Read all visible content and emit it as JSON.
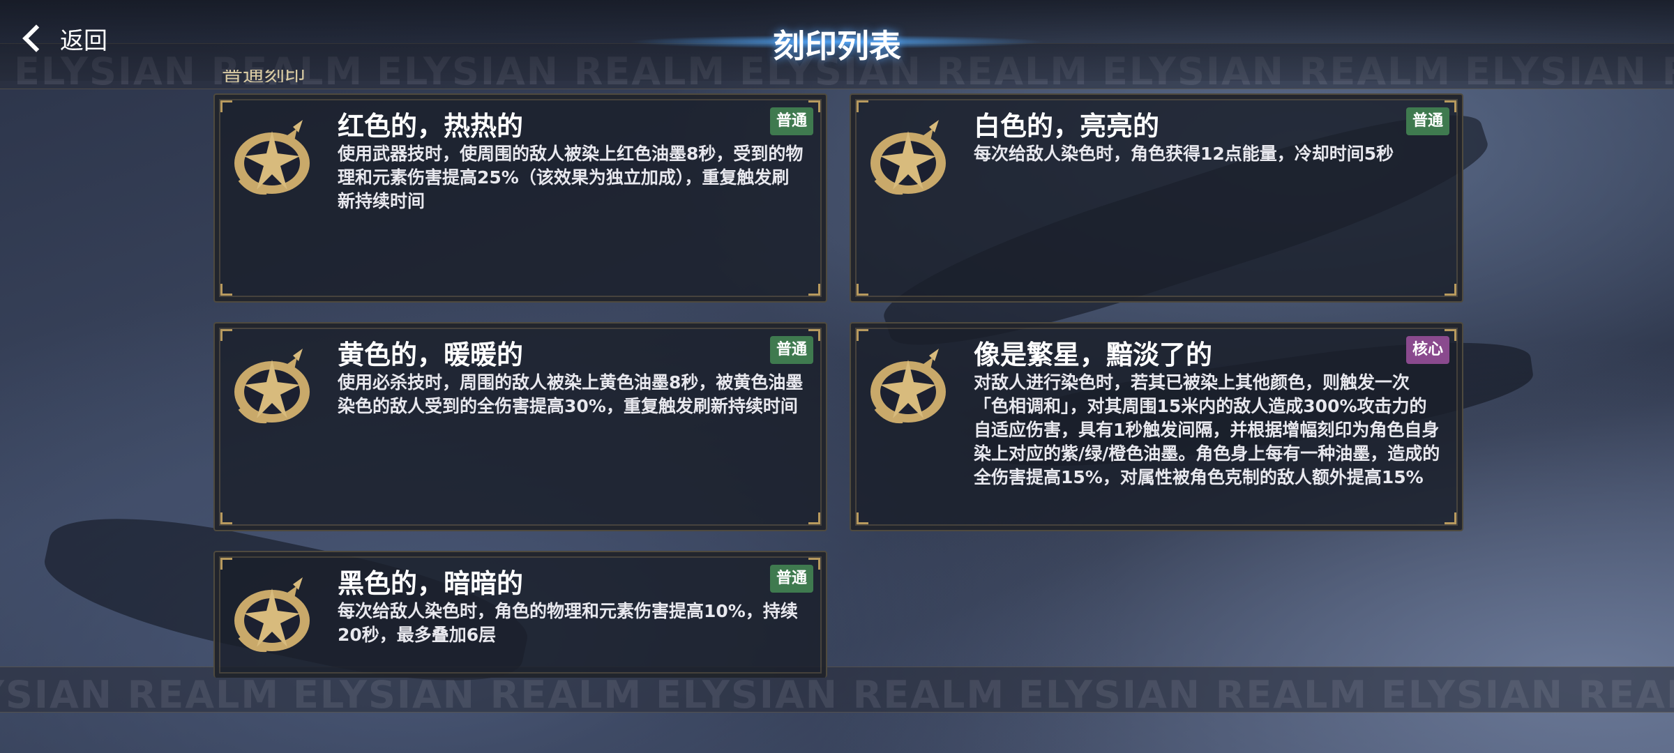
{
  "header": {
    "back_label": "返回",
    "title": "刻印列表",
    "watermark": "ELYSIAN REALM"
  },
  "partial_label": "普通刻印",
  "badge_colors": {
    "普通": "#3f7a4f",
    "核心": "#8a4a8e"
  },
  "cards": [
    {
      "title": "红色的，热热的",
      "badge": "普通",
      "description": "使用武器技时，使周围的敌人被染上红色油墨8秒，受到的物理和元素伤害提高25%（该效果为独立加成），重复触发刷新持续时间",
      "icon": "ink-emblem-icon"
    },
    {
      "title": "白色的，亮亮的",
      "badge": "普通",
      "description": "每次给敌人染色时，角色获得12点能量，冷却时间5秒",
      "icon": "ink-emblem-icon"
    },
    {
      "title": "黄色的，暖暖的",
      "badge": "普通",
      "description": "使用必杀技时，周围的敌人被染上黄色油墨8秒，被黄色油墨染色的敌人受到的全伤害提高30%，重复触发刷新持续时间",
      "icon": "ink-emblem-icon"
    },
    {
      "title": "像是繁星，黯淡了的",
      "badge": "核心",
      "description": "对敌人进行染色时，若其已被染上其他颜色，则触发一次「色相调和」，对其周围15米内的敌人造成300%攻击力的自适应伤害，具有1秒触发间隔，并根据增幅刻印为角色自身染上对应的紫/绿/橙色油墨。角色身上每有一种油墨，造成的全伤害提高15%，对属性被角色克制的敌人额外提高15%",
      "icon": "ink-emblem-icon"
    },
    {
      "title": "黑色的，暗暗的",
      "badge": "普通",
      "description": "每次给敌人染色时，角色的物理和元素伤害提高10%，持续20秒，最多叠加6层",
      "icon": "ink-emblem-icon"
    }
  ]
}
